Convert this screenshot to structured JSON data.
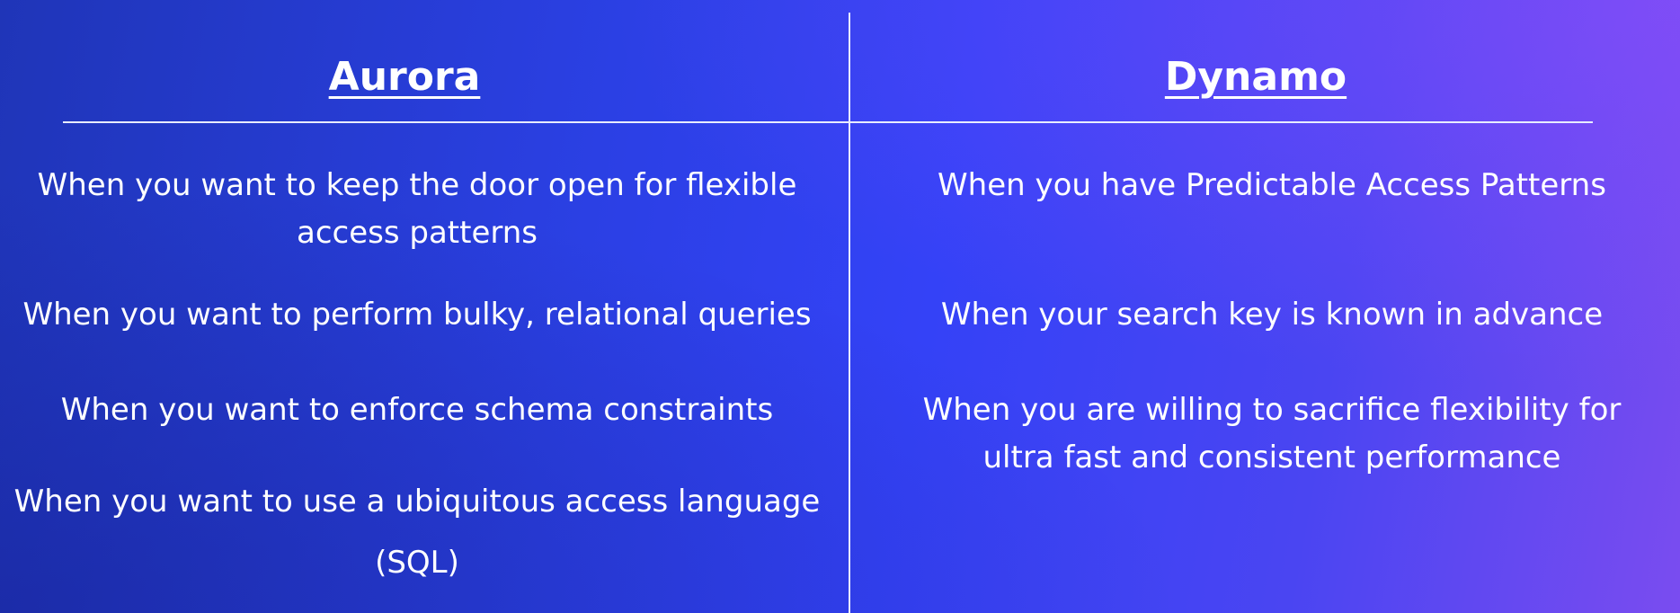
{
  "left": {
    "heading": "Aurora",
    "items": [
      "When you want to keep the door open for flexible access patterns",
      "When you want to perform bulky, relational queries",
      "When you want to enforce schema constraints",
      "When you want to use a ubiquitous access language"
    ],
    "sql": "(SQL)"
  },
  "right": {
    "heading": "Dynamo",
    "items": [
      "When you have Predictable Access Patterns",
      "When your search key is known in advance",
      "When you are willing to sacrifice flexibility for ultra fast and consistent performance"
    ]
  },
  "colors": {
    "background_start": "#1f35b8",
    "background_mid": "#3442f7",
    "background_end": "#7a4cf0",
    "text": "#ffffff",
    "lines": "#e8ecff"
  }
}
